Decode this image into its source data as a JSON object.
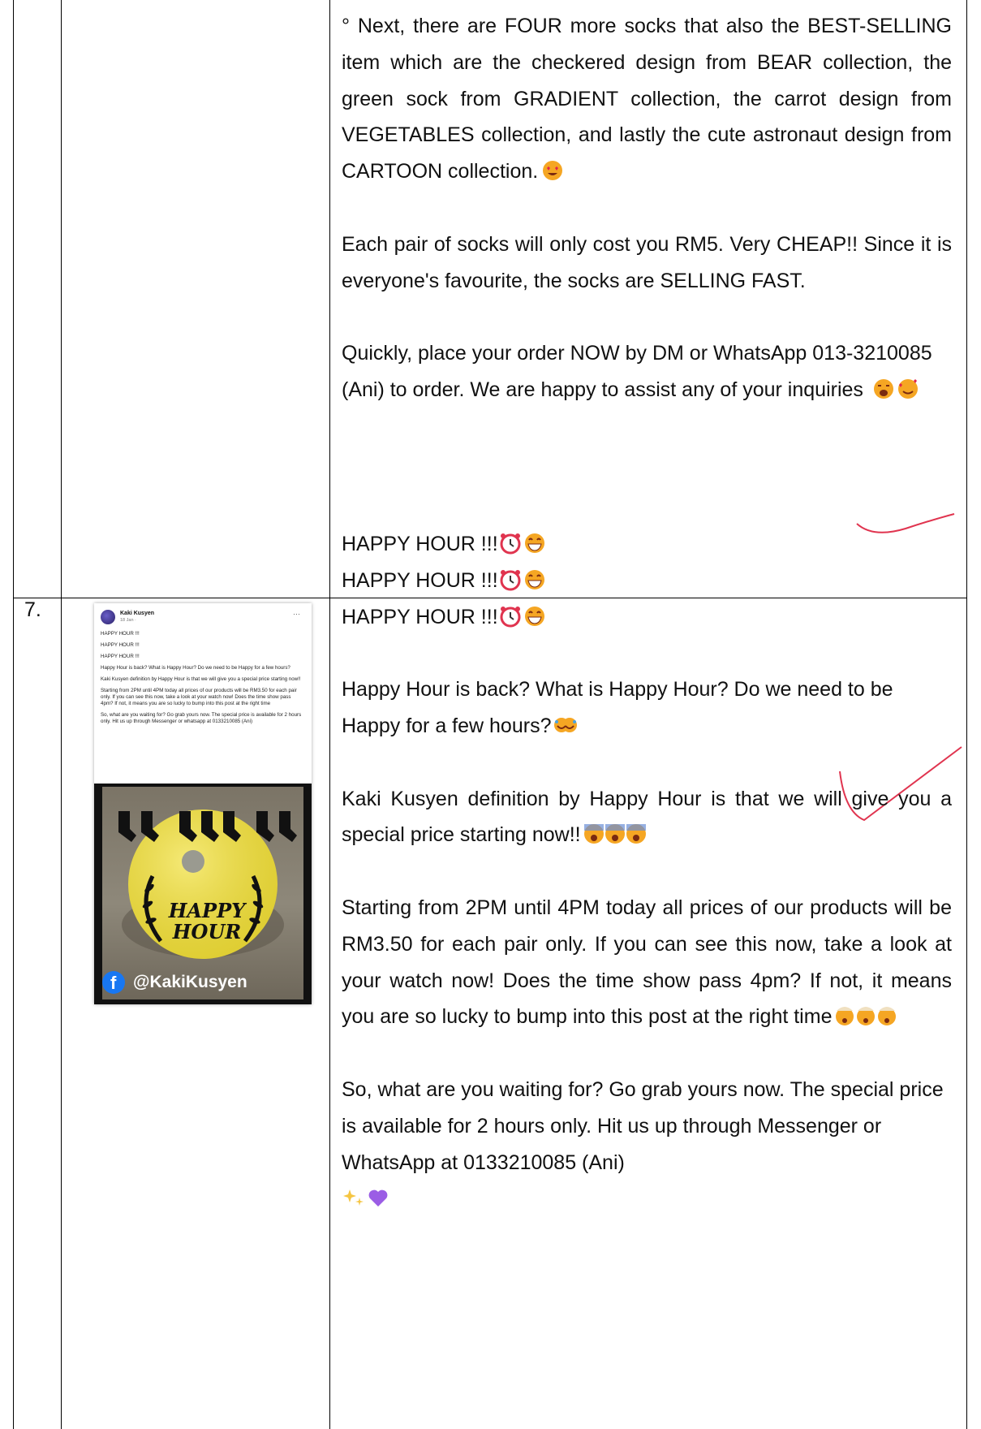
{
  "row_prev": {
    "paragraphs": [
      "° Next, there are FOUR more socks that also the BEST-SELLING item which are the checkered design from BEAR collection, the green sock from GRADIENT collection, the carrot design from VEGETABLES collection, and lastly the cute astronaut design from CARTOON collection.",
      "Each pair of socks will only cost you RM5. Very CHEAP!! Since it is everyone's favourite, the socks are SELLING FAST.",
      "Quickly, place your order NOW by DM or WhatsApp 013-3210085 (Ani) to order. We are happy to assist any of your inquiries"
    ],
    "emoji_names": [
      "heart-eyes-emoji",
      "screaming-emoji",
      "smiling-hearts-emoji"
    ]
  },
  "row7": {
    "number": "7.",
    "lines": [
      "HAPPY HOUR !!!",
      "HAPPY HOUR !!!",
      "HAPPY HOUR !!!"
    ],
    "p1": "Happy Hour is back? What is Happy Hour? Do we need to be Happy for a few hours?",
    "p2": "Kaki Kusyen definition by Happy Hour is that we will give you a special price starting now!!",
    "p3": "Starting from 2PM until 4PM today all prices of our products will be RM3.50 for each pair only. If you can see this now, take a look at your watch now! Does the time show pass 4pm? If not, it means you are so lucky to bump into this post at the right time",
    "p4": "So, what are you waiting for? Go grab yours now. The special price is available for 2 hours only. Hit us up through Messenger or WhatsApp at 0133210085 (Ani)",
    "emoji_names": [
      "alarm-clock-emoji",
      "grinning-emoji",
      "rofl-emoji",
      "screaming-fear-emoji",
      "exploding-head-emoji",
      "sparkles-emoji",
      "purple-heart-emoji"
    ]
  },
  "post": {
    "page_name": "Kaki Kusyen",
    "date": "18 Jan · ",
    "menu": "···",
    "lines": [
      "HAPPY HOUR !!!",
      "HAPPY HOUR !!!",
      "HAPPY HOUR !!!",
      "Happy Hour is back? What is Happy Hour? Do we need to be Happy for a few hours?",
      "Kaki Kusyen definition by Happy Hour is that we will give you a special price starting now!!",
      "Starting from 2PM until 4PM today all prices of our products will be RM3.50 for each pair only. If you can see this now, take a look at your watch now! Does the time show pass 4pm? If not, it means you are so lucky to bump into this post at the right time",
      "So, what are you waiting for? Go grab yours now. The special price is available for 2 hours only. Hit us up through Messenger or whatsapp at 0133210085 (Ani)"
    ],
    "image_title_1": "HAPPY",
    "image_title_2": "HOUR",
    "fb_letter": "f",
    "handle": "@KakiKusyen"
  },
  "colors": {
    "grid": "#000000",
    "annotation": "#e0344f",
    "fb_blue": "#1877f2"
  }
}
